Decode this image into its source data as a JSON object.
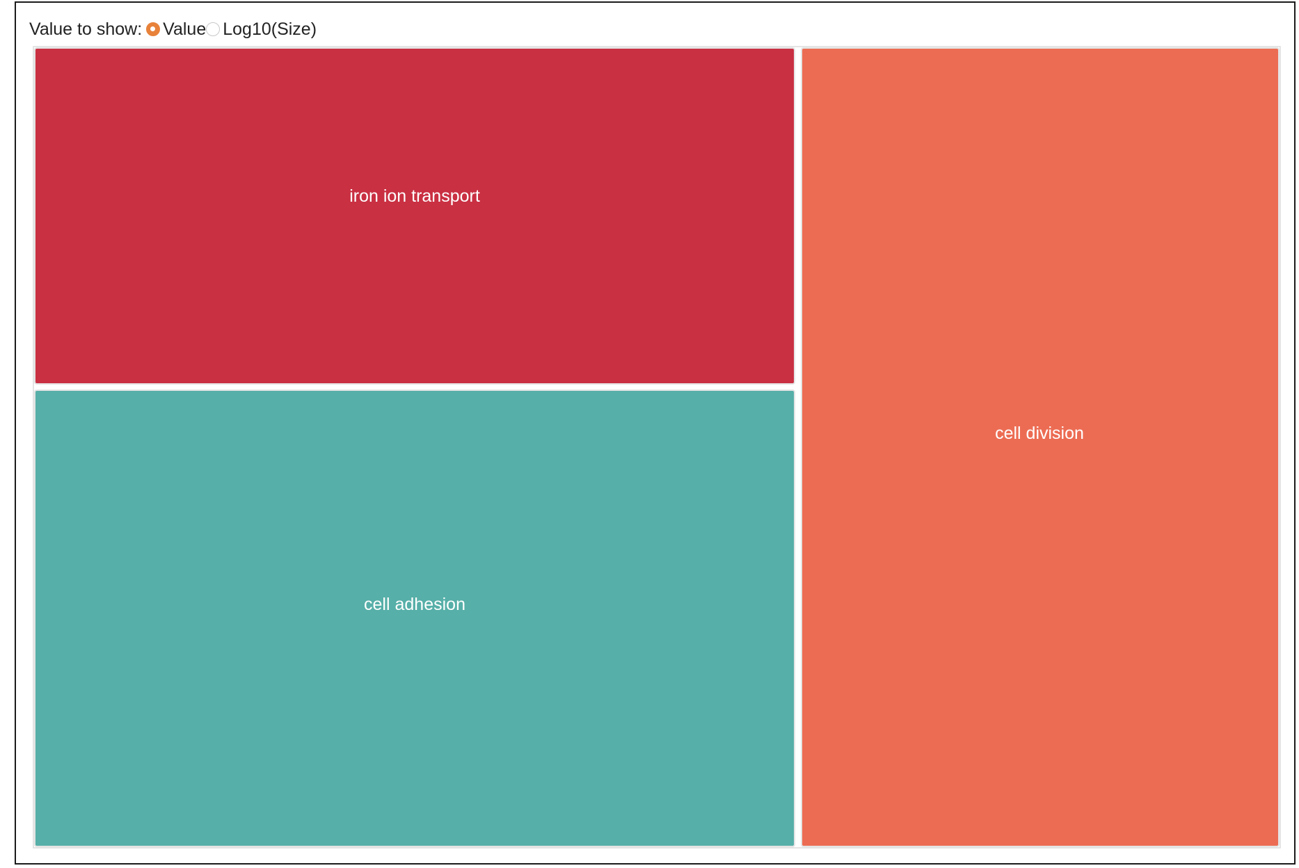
{
  "controls": {
    "label": "Value to show:",
    "options": [
      {
        "label": "Value",
        "selected": true
      },
      {
        "label": "Log10(Size)",
        "selected": false
      }
    ],
    "accent_color": "#e8823a"
  },
  "chart_data": {
    "type": "treemap",
    "tiles": [
      {
        "label": "iron ion transport",
        "color": "#c93042"
      },
      {
        "label": "cell adhesion",
        "color": "#56afa8"
      },
      {
        "label": "cell division",
        "color": "#ec6c53"
      }
    ]
  }
}
